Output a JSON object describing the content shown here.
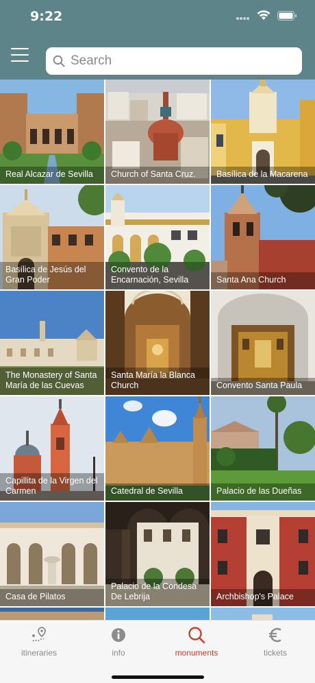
{
  "status_bar": {
    "time": "9:22"
  },
  "header": {
    "search_placeholder": "Search"
  },
  "monuments": [
    {
      "label": "Real Alcazar de Sevilla"
    },
    {
      "label": "Church of Santa Cruz."
    },
    {
      "label": "Basílica de la Macarena"
    },
    {
      "label": "Basílica de Jesús del Gran Poder"
    },
    {
      "label": "Convento de la Encarnación, Sevilla"
    },
    {
      "label": "Santa Ana Church"
    },
    {
      "label": "The Monastery of Santa María de las Cuevas"
    },
    {
      "label": "Santa María la Blanca Church"
    },
    {
      "label": "Convento Santa Paula"
    },
    {
      "label": "Capillita de la Virgen del Carmen"
    },
    {
      "label": "Catedral de Sevilla"
    },
    {
      "label": "Palacio de las Dueñas"
    },
    {
      "label": "Casa de Pilatos"
    },
    {
      "label": "Palacio de la Condesa De Lebrija"
    },
    {
      "label": "Archbishop's Palace"
    }
  ],
  "tabs": [
    {
      "label": "itineraries",
      "icon": "map-pin-icon"
    },
    {
      "label": "info",
      "icon": "info-icon"
    },
    {
      "label": "monuments",
      "icon": "search-icon",
      "active": true
    },
    {
      "label": "tickets",
      "icon": "euro-icon"
    }
  ],
  "colors": {
    "header": "#5d8589",
    "accent": "#c8432e",
    "tab_inactive": "#8c8c8c"
  }
}
